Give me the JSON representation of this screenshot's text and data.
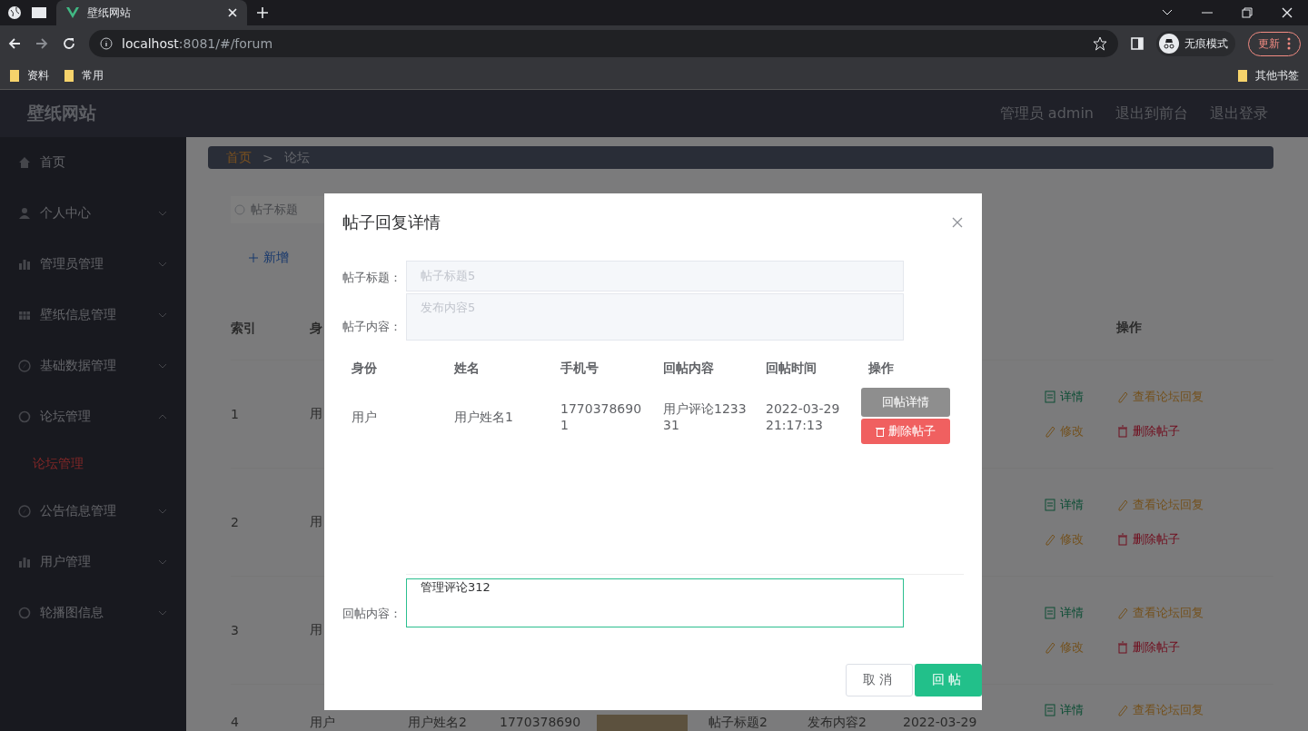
{
  "browser": {
    "tabs": [
      {
        "title": "壁纸网站",
        "selected": true
      }
    ],
    "address": {
      "host": "localhost",
      "rest": ":8081/#/forum"
    },
    "profile": "无痕模式",
    "update_button": "更新",
    "bookmarks": [
      "资料",
      "常用"
    ],
    "other_bookmarks": "其他书签"
  },
  "header": {
    "title": "壁纸网站",
    "links": [
      "管理员 admin",
      "退出到前台",
      "退出登录"
    ]
  },
  "sidebar": {
    "items": [
      {
        "label": "首页",
        "expandable": false,
        "selected": false
      },
      {
        "label": "个人中心",
        "expandable": true,
        "expanded": false,
        "selected": false
      },
      {
        "label": "管理员管理",
        "expandable": true,
        "expanded": false,
        "selected": false
      },
      {
        "label": "壁纸信息管理",
        "expandable": true,
        "expanded": false,
        "selected": false
      },
      {
        "label": "基础数据管理",
        "expandable": true,
        "expanded": false,
        "selected": false
      },
      {
        "label": "论坛管理",
        "expandable": true,
        "expanded": true,
        "selected": false,
        "children": [
          {
            "label": "论坛管理",
            "selected": true
          }
        ]
      },
      {
        "label": "公告信息管理",
        "expandable": true,
        "expanded": false,
        "selected": false
      },
      {
        "label": "用户管理",
        "expandable": true,
        "expanded": false,
        "selected": false
      },
      {
        "label": "轮播图信息",
        "expandable": true,
        "expanded": false,
        "selected": false
      }
    ]
  },
  "breadcrumb": {
    "items": [
      "首页",
      "论坛"
    ],
    "separator": ">"
  },
  "search": {
    "placeholder": "帖子标题"
  },
  "add_button": {
    "label": "新增"
  },
  "table": {
    "columns": [
      "索引",
      "身",
      "操作"
    ],
    "rows": [
      {
        "index": "1",
        "identity": "用",
        "actions": [
          {
            "label": "详情",
            "kind": "detail"
          },
          {
            "label": "查看论坛回复",
            "kind": "view"
          },
          {
            "label": "修改",
            "kind": "edit"
          },
          {
            "label": "删除帖子",
            "kind": "delete"
          }
        ]
      },
      {
        "index": "2",
        "identity": "用",
        "actions": [
          {
            "label": "详情",
            "kind": "detail"
          },
          {
            "label": "查看论坛回复",
            "kind": "view"
          },
          {
            "label": "修改",
            "kind": "edit"
          },
          {
            "label": "删除帖子",
            "kind": "delete"
          }
        ]
      },
      {
        "index": "3",
        "identity": "用",
        "actions": [
          {
            "label": "详情",
            "kind": "detail"
          },
          {
            "label": "查看论坛回复",
            "kind": "view"
          },
          {
            "label": "修改",
            "kind": "edit"
          },
          {
            "label": "删除帖子",
            "kind": "delete"
          }
        ]
      },
      {
        "index": "4",
        "identity": "用户",
        "name": "用户姓名2",
        "phone": "1770378690",
        "title": "帖子标题2",
        "content": "发布内容2",
        "time": "2022-03-29",
        "actions": [
          {
            "label": "详情",
            "kind": "detail"
          },
          {
            "label": "查看论坛回复",
            "kind": "view"
          }
        ]
      }
    ]
  },
  "dialog": {
    "title": "帖子回复详情",
    "fields": [
      {
        "label": "帖子标题：",
        "value": "帖子标题5",
        "kind": "input",
        "disabled": true
      },
      {
        "label": "帖子内容：",
        "value": "发布内容5",
        "kind": "textarea",
        "disabled": true
      }
    ],
    "replies": {
      "columns": [
        "身份",
        "姓名",
        "手机号",
        "回帖内容",
        "回帖时间",
        "操作"
      ],
      "rows": [
        {
          "cells": [
            "用户",
            "用户姓名1",
            "17703786901",
            "用户评论123331",
            "2022-03-29 21:17:13"
          ],
          "actions": [
            {
              "label": "回帖详情",
              "kind": "detail"
            },
            {
              "label": "删除帖子",
              "kind": "delete"
            }
          ]
        }
      ]
    },
    "reply_field": {
      "label": "回帖内容：",
      "value": "管理评论312"
    },
    "buttons": [
      {
        "label": "取消",
        "kind": "default"
      },
      {
        "label": "回帖",
        "kind": "primary"
      }
    ]
  }
}
